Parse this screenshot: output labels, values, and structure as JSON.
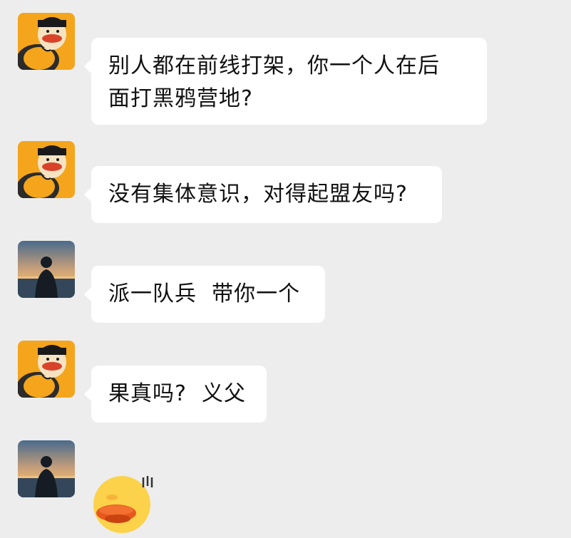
{
  "messages": [
    {
      "sender": "cartoon",
      "text_line1": "别人都在前线打架，你一个人在后",
      "text_line2": "面打黑鸦营地?"
    },
    {
      "sender": "cartoon",
      "text": "没有集体意识，对得起盟友吗?"
    },
    {
      "sender": "silhouette",
      "text": "派一队兵  带你一个"
    },
    {
      "sender": "cartoon",
      "text": "果真吗?  义父"
    },
    {
      "sender": "silhouette",
      "sticker": "pouting-duck-emoji"
    }
  ],
  "colors": {
    "background": "#ededed",
    "bubble": "#ffffff",
    "text": "#111111",
    "cartoon_avatar_bg": "#f4a51c",
    "sticker_face": "#fbd24a"
  }
}
